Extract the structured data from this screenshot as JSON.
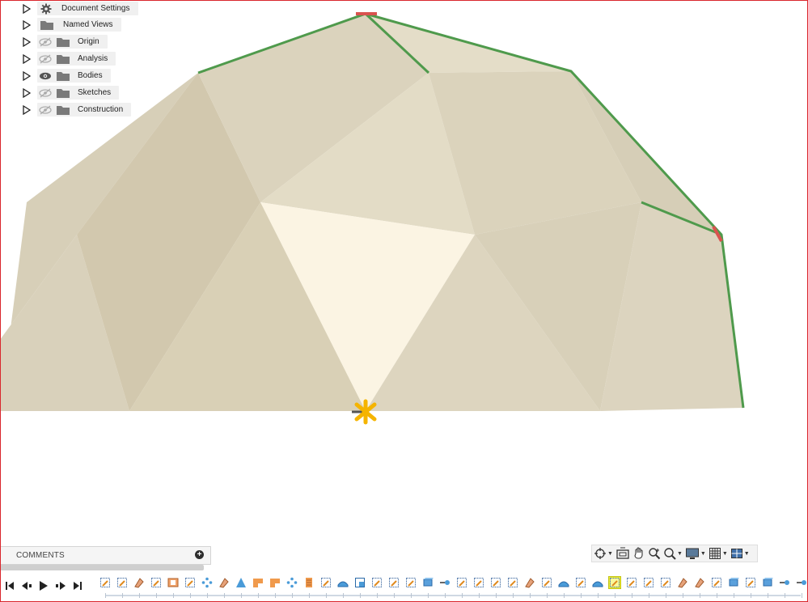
{
  "browser": {
    "items": [
      {
        "label": "Document Settings",
        "icon": "gear-icon",
        "eye": "none"
      },
      {
        "label": "Named Views",
        "icon": "folder-icon",
        "eye": "none"
      },
      {
        "label": "Origin",
        "icon": "folder-icon",
        "eye": "hidden"
      },
      {
        "label": "Analysis",
        "icon": "folder-icon",
        "eye": "hidden"
      },
      {
        "label": "Bodies",
        "icon": "folder-icon",
        "eye": "visible"
      },
      {
        "label": "Sketches",
        "icon": "folder-icon",
        "eye": "hidden"
      },
      {
        "label": "Construction",
        "icon": "folder-icon",
        "eye": "hidden"
      }
    ]
  },
  "comments": {
    "label": "COMMENTS",
    "add_icon": "plus-circle-icon"
  },
  "navbar": {
    "tools": [
      "orbit-icon",
      "look-at-icon",
      "pan-icon",
      "zoom-icon",
      "fit-icon",
      "display-settings-icon",
      "grid-icon",
      "viewports-icon"
    ]
  },
  "timeline": {
    "controls": [
      "go-to-start-icon",
      "step-back-icon",
      "play-icon",
      "step-forward-icon",
      "go-to-end-icon"
    ],
    "features": [
      "sketch",
      "sketch",
      "chamfer",
      "sketch",
      "mirror",
      "sketch",
      "pattern",
      "chamfer",
      "loft",
      "extrude",
      "extrude",
      "pattern",
      "thicken",
      "sketch",
      "surface",
      "face",
      "sketch",
      "sketch",
      "sketch",
      "plane",
      "joint",
      "sketch",
      "sketch",
      "sketch",
      "sketch",
      "chamfer",
      "sketch",
      "surface",
      "sketch",
      "surface",
      "sketch-selected",
      "sketch",
      "sketch",
      "sketch",
      "chamfer",
      "chamfer",
      "sketch",
      "plane",
      "sketch",
      "plane",
      "joint",
      "joint"
    ]
  },
  "colors": {
    "accent_frame": "#d9262c",
    "edge_green": "#4f9a4c",
    "edge_red": "#d9534f",
    "pivot_yellow": "#f5b400",
    "selected_feature": "#f2f22a"
  }
}
